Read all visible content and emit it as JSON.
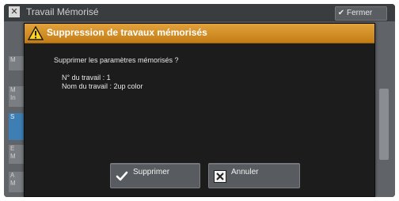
{
  "background_app": {
    "title": "Travail Mémorisé",
    "close_label": "Fermer",
    "sidebar_items": [
      "M",
      "M\nIn",
      "S",
      "E\nM",
      "A\nM"
    ]
  },
  "dialog": {
    "title": "Suppression de travaux mémorisés",
    "question": "Supprimer les paramètres mémorisés ?",
    "job_number": "N° du travail : 1",
    "job_name": "Nom du travail : 2up color",
    "confirm_label": "Supprimer",
    "cancel_label": "Annuler"
  },
  "colors": {
    "header_orange": "#d9921f",
    "dialog_bg": "#1c1c1c",
    "button_bg": "#585b5f"
  }
}
